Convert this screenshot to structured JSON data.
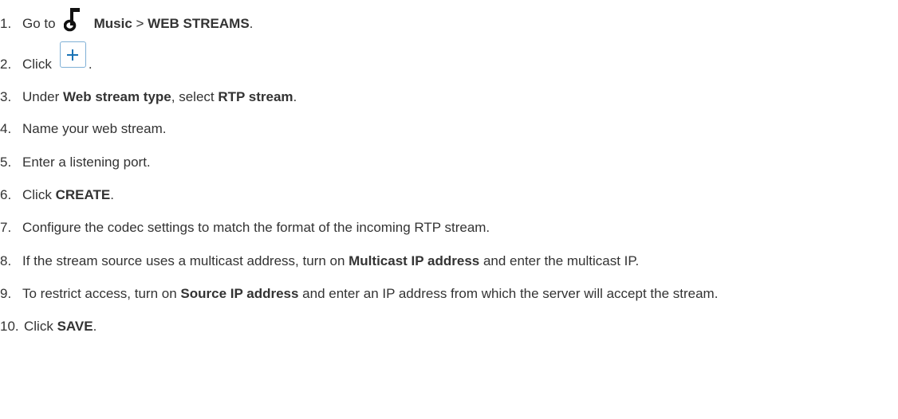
{
  "steps": [
    {
      "num": "1.",
      "t1": "Go to",
      "t2": "Music",
      "t3": " > ",
      "t4": "WEB STREAMS",
      "t5": "."
    },
    {
      "num": "2.",
      "t1": "Click",
      "t2": "."
    },
    {
      "num": "3.",
      "t1": "Under ",
      "t2": "Web stream type",
      "t3": ", select ",
      "t4": "RTP stream",
      "t5": "."
    },
    {
      "num": "4.",
      "t1": "Name your web stream."
    },
    {
      "num": "5.",
      "t1": "Enter a listening port."
    },
    {
      "num": "6.",
      "t1": "Click ",
      "t2": "CREATE",
      "t3": "."
    },
    {
      "num": "7.",
      "t1": "Configure the codec settings to match the format of the incoming RTP stream."
    },
    {
      "num": "8.",
      "t1": "If the stream source uses a multicast address, turn on ",
      "t2": "Multicast IP address",
      "t3": " and enter the multicast IP."
    },
    {
      "num": "9.",
      "t1": "To restrict access, turn on ",
      "t2": "Source IP address",
      "t3": " and enter an IP address from which the server will accept the stream."
    },
    {
      "num": "10.",
      "t1": "Click ",
      "t2": "SAVE",
      "t3": "."
    }
  ],
  "icons": {
    "music": "music-note-icon",
    "add": "plus-icon",
    "accent_color": "#1a73b5",
    "border_color": "#7fb0d6"
  }
}
